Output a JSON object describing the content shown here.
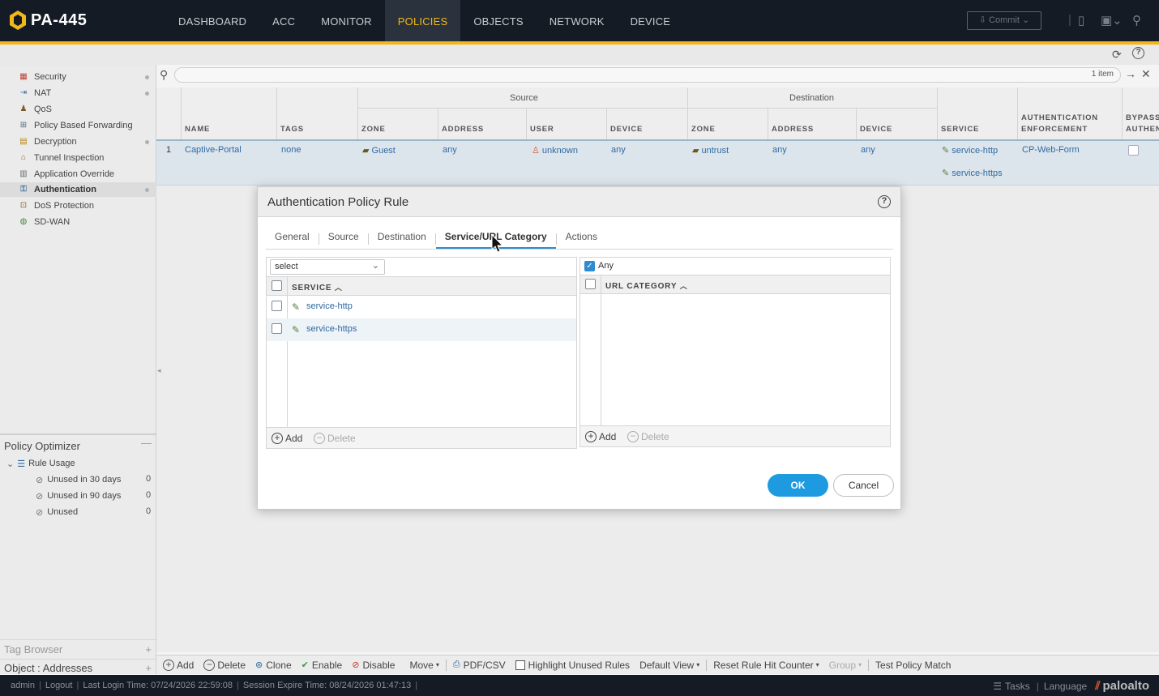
{
  "header": {
    "brand": "PA-445",
    "nav": [
      "DASHBOARD",
      "ACC",
      "MONITOR",
      "POLICIES",
      "OBJECTS",
      "NETWORK",
      "DEVICE"
    ],
    "active_nav": "POLICIES",
    "commit_label": "Commit"
  },
  "sidebar": {
    "items": [
      {
        "label": "Security",
        "icon": "security-icon"
      },
      {
        "label": "NAT",
        "icon": "nat-icon"
      },
      {
        "label": "QoS",
        "icon": "qos-icon"
      },
      {
        "label": "Policy Based Forwarding",
        "icon": "pbf-icon"
      },
      {
        "label": "Decryption",
        "icon": "decryption-icon"
      },
      {
        "label": "Tunnel Inspection",
        "icon": "tunnel-icon"
      },
      {
        "label": "Application Override",
        "icon": "app-override-icon"
      },
      {
        "label": "Authentication",
        "icon": "authentication-icon"
      },
      {
        "label": "DoS Protection",
        "icon": "dos-icon"
      },
      {
        "label": "SD-WAN",
        "icon": "sdwan-icon"
      }
    ],
    "active_item": "Authentication",
    "optimizer": {
      "title": "Policy Optimizer",
      "group": "Rule Usage",
      "items": [
        {
          "label": "Unused in 30 days",
          "count": "0"
        },
        {
          "label": "Unused in 90 days",
          "count": "0"
        },
        {
          "label": "Unused",
          "count": "0"
        }
      ]
    },
    "tag_browser": "Tag Browser",
    "object_addresses": "Object : Addresses"
  },
  "search": {
    "count": "1 item"
  },
  "table": {
    "group_source": "Source",
    "group_destination": "Destination",
    "columns": [
      "NAME",
      "TAGS",
      "ZONE",
      "ADDRESS",
      "USER",
      "DEVICE",
      "ZONE",
      "ADDRESS",
      "DEVICE",
      "SERVICE",
      "AUTHENTICATION",
      "ENFORCEMENT",
      "BYPASS",
      "AUTHEN"
    ],
    "row": {
      "index": "1",
      "name": "Captive-Portal",
      "tags": "none",
      "src_zone": "Guest",
      "src_address": "any",
      "src_user": "unknown",
      "src_device": "any",
      "dst_zone": "untrust",
      "dst_address": "any",
      "dst_device": "any",
      "service_1": "service-http",
      "service_2": "service-https",
      "auth_enforcement": "CP-Web-Form"
    }
  },
  "modal": {
    "title": "Authentication Policy Rule",
    "tabs": [
      "General",
      "Source",
      "Destination",
      "Service/URL Category",
      "Actions"
    ],
    "active_tab": "Service/URL Category",
    "service": {
      "select_value": "select",
      "column": "SERVICE",
      "items": [
        "service-http",
        "service-https"
      ],
      "add": "Add",
      "delete": "Delete"
    },
    "url": {
      "any_label": "Any",
      "any_checked": true,
      "column": "URL CATEGORY",
      "add": "Add",
      "delete": "Delete"
    },
    "ok": "OK",
    "cancel": "Cancel"
  },
  "bottombar": {
    "add": "Add",
    "delete": "Delete",
    "clone": "Clone",
    "enable": "Enable",
    "disable": "Disable",
    "move": "Move",
    "pdf_csv": "PDF/CSV",
    "highlight": "Highlight Unused Rules",
    "default_view": "Default View",
    "reset": "Reset Rule Hit Counter",
    "group": "Group",
    "test": "Test Policy Match"
  },
  "status": {
    "user": "admin",
    "logout": "Logout",
    "last_login": "Last Login Time: 07/24/2026 22:59:08",
    "session_expire": "Session Expire Time: 08/24/2026 01:47:13",
    "tasks": "Tasks",
    "language": "Language",
    "vendor": "paloalto"
  },
  "colors": {
    "accent": "#f2b81b",
    "link": "#2f6aa3",
    "primary_button": "#1e9be0",
    "topbar": "#141b24"
  }
}
